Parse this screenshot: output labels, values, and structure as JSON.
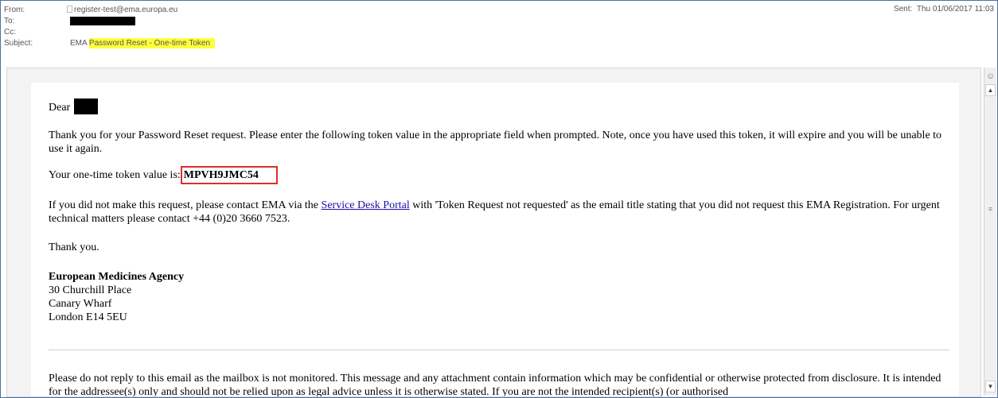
{
  "header": {
    "from_label": "From:",
    "from_value": "register-test@ema.europa.eu",
    "to_label": "To:",
    "cc_label": "Cc:",
    "subject_label": "Subject:",
    "subject_prefix": "EMA ",
    "subject_highlight": "Password Reset - One-time Token",
    "sent_label": "Sent:",
    "sent_value": "Thu 01/06/2017 11:03"
  },
  "body": {
    "greeting": "Dear",
    "para1": "Thank you for your Password Reset request. Please enter the following token value in the appropriate field when prompted. Note, once you have used this token, it will expire and you will be unable to use it again.",
    "token_label": "Your one-time token value is:",
    "token_value": "MPVH9JMC54",
    "para3_before": "If you did not make this request, please contact EMA via the ",
    "para3_link": "Service Desk Portal",
    "para3_after": " with 'Token Request not requested' as the email title stating that you did not request this EMA Registration. For urgent technical matters please contact +44 (0)20 3660 7523.",
    "thanks": "Thank you.",
    "sig_org": "European Medicines Agency",
    "sig_line1": "30 Churchill Place",
    "sig_line2": "Canary Wharf",
    "sig_line3": "London E14 5EU",
    "footer": "Please do not reply to this email as the mailbox is not monitored. This message and any attachment contain information which may be confidential or otherwise protected from disclosure. It is intended for the addressee(s) only and should not be relied upon as legal advice unless it is otherwise stated. If you are not the intended recipient(s) (or authorised"
  },
  "scrollbar": {
    "top_icon": "people-icon",
    "up_icon": "arrow-up-icon",
    "down_icon": "arrow-down-icon",
    "grip_icon": "grip-icon"
  }
}
